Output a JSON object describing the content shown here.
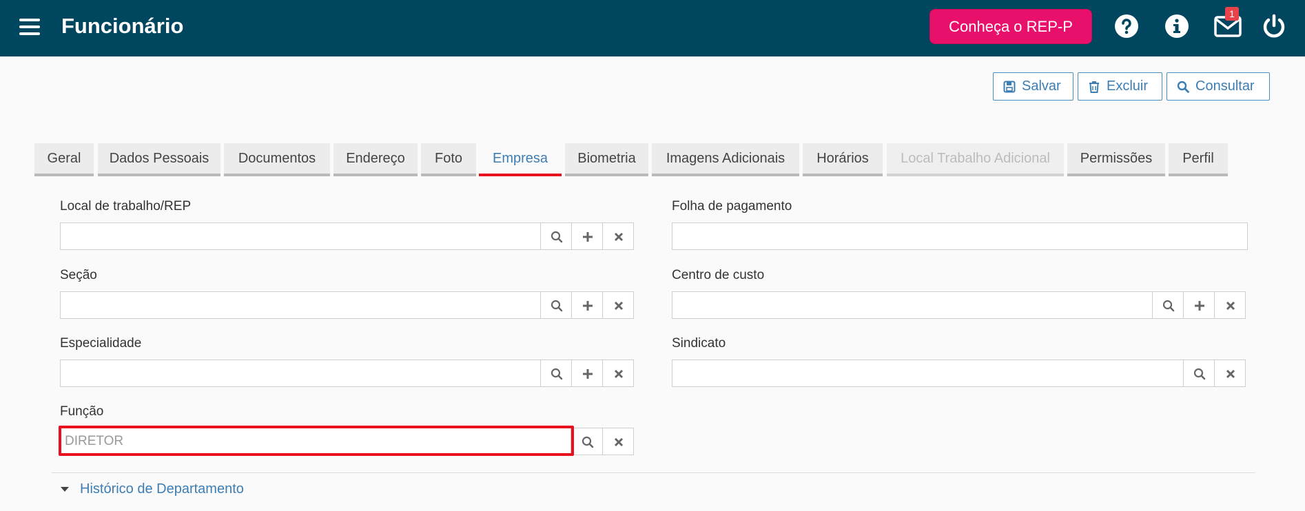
{
  "header": {
    "title": "Funcionário",
    "rep_button": "Conheça o REP-P",
    "notification_count": "1",
    "icons": [
      "menu-icon",
      "help-icon",
      "info-icon",
      "envelope-icon",
      "power-icon"
    ]
  },
  "toolbar": {
    "save": "Salvar",
    "delete": "Excluir",
    "search": "Consultar"
  },
  "tabs": [
    {
      "label": "Geral"
    },
    {
      "label": "Dados Pessoais"
    },
    {
      "label": "Documentos"
    },
    {
      "label": "Endereço"
    },
    {
      "label": "Foto"
    },
    {
      "label": "Empresa",
      "active": true
    },
    {
      "label": "Biometria"
    },
    {
      "label": "Imagens Adicionais"
    },
    {
      "label": "Horários"
    },
    {
      "label": "Local Trabalho Adicional",
      "disabled": true
    },
    {
      "label": "Permissões"
    },
    {
      "label": "Perfil"
    }
  ],
  "form": {
    "local_trabalho": {
      "label": "Local de trabalho/REP",
      "value": ""
    },
    "folha_pagamento": {
      "label": "Folha de pagamento",
      "value": ""
    },
    "secao": {
      "label": "Seção",
      "value": ""
    },
    "centro_custo": {
      "label": "Centro de custo",
      "value": ""
    },
    "especialidade": {
      "label": "Especialidade",
      "value": ""
    },
    "sindicato": {
      "label": "Sindicato",
      "value": ""
    },
    "funcao": {
      "label": "Função",
      "value": "DIRETOR"
    }
  },
  "history": {
    "label": "Histórico de Departamento"
  },
  "colors": {
    "header_bg": "#00465e",
    "accent_pink": "#e8106a",
    "link_blue": "#3c7eb4",
    "highlight_red": "#e8101e"
  }
}
